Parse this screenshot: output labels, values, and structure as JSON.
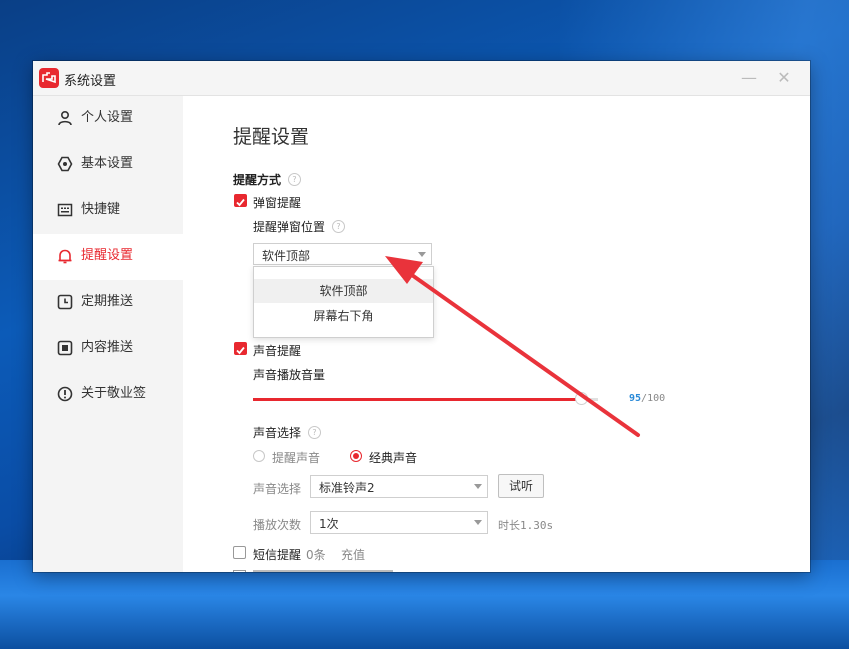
{
  "window": {
    "title": "系统设置",
    "minimize": "—",
    "close": "✕"
  },
  "sidebar": {
    "items": [
      {
        "label": "个人设置",
        "icon": "user-icon",
        "active": false
      },
      {
        "label": "基本设置",
        "icon": "gear-icon",
        "active": false
      },
      {
        "label": "快捷键",
        "icon": "keyboard-icon",
        "active": false
      },
      {
        "label": "提醒设置",
        "icon": "bell-icon",
        "active": true
      },
      {
        "label": "定期推送",
        "icon": "clock-icon",
        "active": false
      },
      {
        "label": "内容推送",
        "icon": "content-icon",
        "active": false
      },
      {
        "label": "关于敬业签",
        "icon": "info-icon",
        "active": false
      }
    ]
  },
  "main": {
    "title": "提醒设置",
    "reminder_method": {
      "label": "提醒方式",
      "help": "?",
      "popup": {
        "label": "弹窗提醒",
        "checked": true,
        "position_label": "提醒弹窗位置",
        "position_value": "软件顶部",
        "options": [
          "软件顶部",
          "屏幕右下角"
        ]
      },
      "sound": {
        "label": "声音提醒",
        "checked": true,
        "volume_label": "声音播放音量",
        "volume_value": "95",
        "volume_max": "/100",
        "volume_fraction": 0.95,
        "sound_choice_label": "声音选择",
        "radio_reminder": "提醒声音",
        "radio_classic": "经典声音",
        "radio_selected": "经典声音",
        "select_label": "声音选择",
        "select_value": "标准铃声2",
        "listen_button": "试听",
        "play_count_label": "播放次数",
        "play_count_value": "1次",
        "duration": "时长1.30s"
      },
      "sms": {
        "label": "短信提醒",
        "checked": false,
        "count": "0条",
        "recharge": "充值"
      }
    }
  },
  "colors": {
    "accent": "#e8282f",
    "link": "#2a8ad8"
  }
}
